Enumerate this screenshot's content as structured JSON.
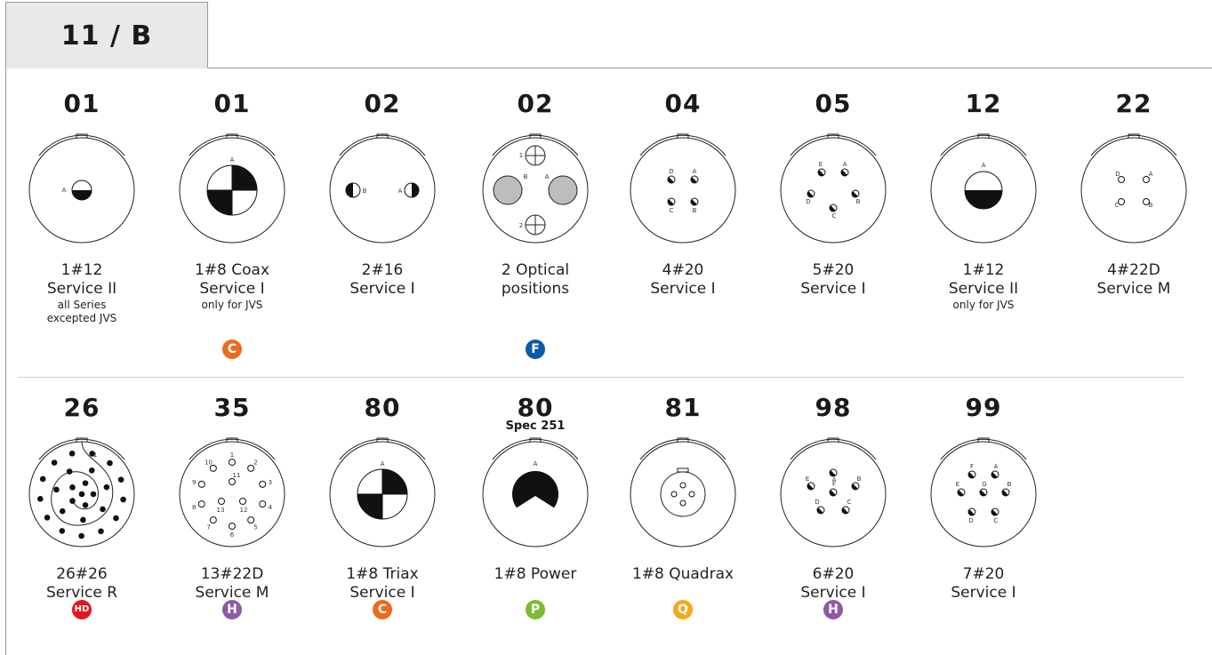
{
  "tab": {
    "label": "11 / B"
  },
  "colors": {
    "orange": "#ec6b1c",
    "blue": "#0b5aa8",
    "red": "#e3161f",
    "purple": "#8e5aa8",
    "green": "#7cbb34",
    "yellow": "#f6a71a",
    "gray_fill": "#bdbdbd"
  },
  "row1": [
    {
      "code": "01",
      "line1": "1#12",
      "line2": "Service II",
      "note1": "all Series",
      "note2": "excepted JVS",
      "diagram": "single-half-small",
      "pin_labels": [
        "A"
      ]
    },
    {
      "code": "01",
      "line1": "1#8 Coax",
      "line2": "Service I",
      "note1": "only for JVS",
      "badge": "C",
      "badge_color": "orange",
      "diagram": "quad-large",
      "pin_labels": [
        "A"
      ]
    },
    {
      "code": "02",
      "line1": "2#16",
      "line2": "Service I",
      "diagram": "two-half",
      "pin_labels": [
        "B",
        "A"
      ]
    },
    {
      "code": "02",
      "line1": "2 Optical",
      "line2": "positions",
      "badge": "F",
      "badge_color": "blue",
      "diagram": "optical",
      "pin_labels": [
        "1",
        "B",
        "A",
        "2"
      ]
    },
    {
      "code": "04",
      "line1": "4#20",
      "line2": "Service I",
      "diagram": "four-pin",
      "pin_labels": [
        "D",
        "A",
        "C",
        "B"
      ]
    },
    {
      "code": "05",
      "line1": "5#20",
      "line2": "Service I",
      "diagram": "five-pin",
      "pin_labels": [
        "E",
        "A",
        "D",
        "B",
        "C"
      ]
    },
    {
      "code": "12",
      "line1": "1#12",
      "line2": "Service II",
      "note1": "only for JVS",
      "diagram": "single-half-large",
      "pin_labels": [
        "A"
      ]
    },
    {
      "code": "22",
      "line1": "4#22D",
      "line2": "Service M",
      "diagram": "four-open",
      "pin_labels": [
        "D",
        "A",
        "C",
        "B"
      ]
    }
  ],
  "row2": [
    {
      "code": "26",
      "line1": "26#26",
      "line2": "Service R",
      "badge": "HD",
      "badge_color": "red",
      "diagram": "spiral",
      "pin_labels": [
        "1"
      ]
    },
    {
      "code": "35",
      "line1": "13#22D",
      "line2": "Service M",
      "badge": "H",
      "badge_color": "purple",
      "diagram": "thirteen",
      "pin_labels": [
        "1",
        "2",
        "3",
        "4",
        "5",
        "6",
        "7",
        "8",
        "9",
        "10",
        "11",
        "12",
        "13"
      ]
    },
    {
      "code": "80",
      "line1": "1#8 Triax",
      "line2": "Service I",
      "badge": "C",
      "badge_color": "orange",
      "diagram": "quad-large",
      "pin_labels": [
        "A"
      ]
    },
    {
      "code": "80",
      "spec": "Spec 251",
      "line1": "1#8 Power",
      "line2": "",
      "badge": "P",
      "badge_color": "green",
      "diagram": "power",
      "pin_labels": [
        "A"
      ]
    },
    {
      "code": "81",
      "line1": "1#8 Quadrax",
      "line2": "",
      "badge": "Q",
      "badge_color": "yellow",
      "diagram": "quadrax",
      "pin_labels": []
    },
    {
      "code": "98",
      "line1": "6#20",
      "line2": "Service I",
      "badge": "H",
      "badge_color": "purple",
      "diagram": "six-pin",
      "pin_labels": [
        "A",
        "E",
        "F",
        "B",
        "D",
        "C"
      ]
    },
    {
      "code": "99",
      "line1": "7#20",
      "line2": "Service I",
      "diagram": "seven-pin",
      "pin_labels": [
        "F",
        "A",
        "E",
        "G",
        "B",
        "D",
        "C"
      ]
    }
  ]
}
